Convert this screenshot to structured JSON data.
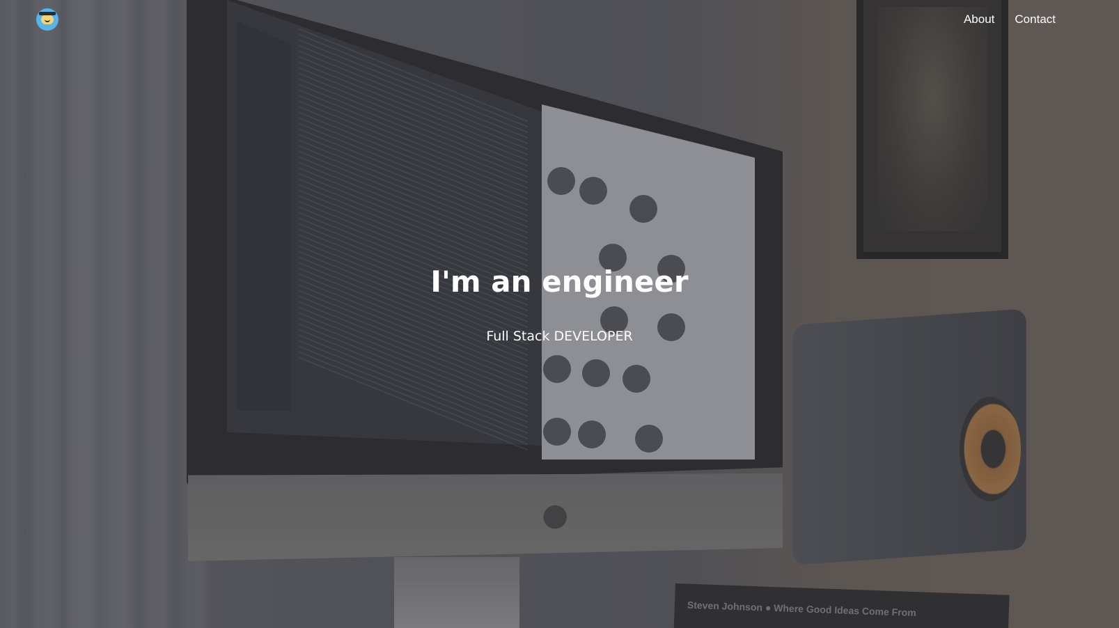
{
  "header": {
    "logo_icon": "graduation-cap-emoji-icon",
    "logo_color": "#56b4e8",
    "nav": [
      {
        "label": "About"
      },
      {
        "label": "Contact"
      }
    ]
  },
  "hero": {
    "title": "I'm an engineer",
    "subtitle": "Full Stack DEVELOPER",
    "background_image": "desk-with-imac-code-editor-photo",
    "book_text": "Steven Johnson  ●  Where Good Ideas Come From"
  }
}
